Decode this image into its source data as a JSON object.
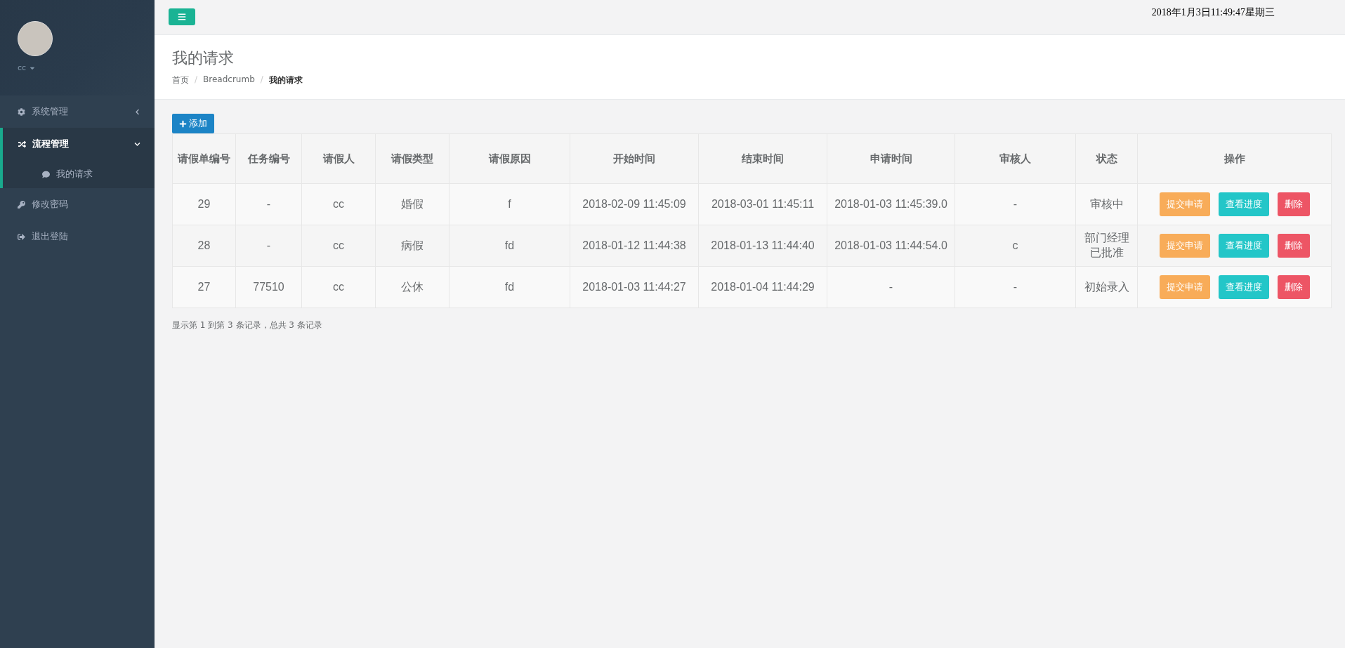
{
  "sidebar": {
    "user": {
      "name": "cc"
    },
    "items": [
      {
        "label": "系统管理",
        "selected": false,
        "expanded": false
      },
      {
        "label": "流程管理",
        "selected": true,
        "expanded": true,
        "children": [
          {
            "label": "我的请求",
            "selected": false
          }
        ]
      },
      {
        "label": "修改密码",
        "selected": false
      },
      {
        "label": "退出登陆",
        "selected": false
      }
    ]
  },
  "topbar": {
    "datetime": "2018年1月3日11:49:47星期三"
  },
  "page_header": {
    "title": "我的请求",
    "breadcrumb": [
      {
        "label": "首页",
        "current": false
      },
      {
        "label": "Breadcrumb",
        "separator": "/",
        "current": false
      },
      {
        "label": "我的请求",
        "separator": "/",
        "current": true
      }
    ]
  },
  "add_button": {
    "label": "添加"
  },
  "table": {
    "columns": [
      "请假单编号",
      "任务编号",
      "请假人",
      "请假类型",
      "请假原因",
      "开始时间",
      "结束时间",
      "申请时间",
      "审核人",
      "状态",
      "操作"
    ],
    "rows": [
      {
        "cells": [
          "29",
          "-",
          "cc",
          "婚假",
          "f",
          "2018-02-09 11:45:09",
          "2018-03-01 11:45:11",
          "2018-01-03 11:45:39.0",
          "-",
          "审核中"
        ],
        "actions": [
          {
            "label": "提交申请",
            "kind": "warning"
          },
          {
            "label": "查看进度",
            "kind": "info"
          },
          {
            "label": "删除",
            "kind": "danger"
          }
        ]
      },
      {
        "cells": [
          "28",
          "-",
          "cc",
          "病假",
          "fd",
          "2018-01-12 11:44:38",
          "2018-01-13 11:44:40",
          "2018-01-03 11:44:54.0",
          "c",
          "部门经理已批准"
        ],
        "actions": [
          {
            "label": "提交申请",
            "kind": "warning"
          },
          {
            "label": "查看进度",
            "kind": "info"
          },
          {
            "label": "删除",
            "kind": "danger"
          }
        ]
      },
      {
        "cells": [
          "27",
          "77510",
          "cc",
          "公休",
          "fd",
          "2018-01-03 11:44:27",
          "2018-01-04 11:44:29",
          "-",
          "-",
          "初始录入"
        ],
        "actions": [
          {
            "label": "提交申请",
            "kind": "warning"
          },
          {
            "label": "查看进度",
            "kind": "info"
          },
          {
            "label": "删除",
            "kind": "danger"
          }
        ]
      }
    ]
  },
  "pagination_info": "显示第 1 到第 3 条记录，总共 3 条记录"
}
